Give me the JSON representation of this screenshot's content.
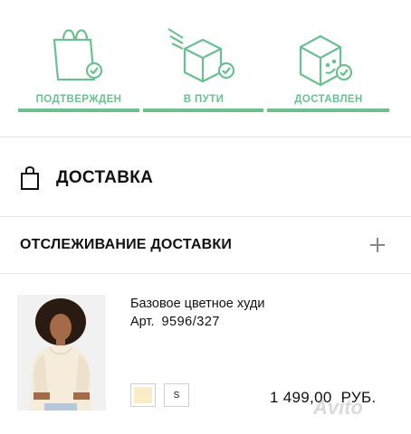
{
  "order_status": {
    "steps": [
      {
        "label": "ПОДТВЕРЖДЕН"
      },
      {
        "label": "В ПУТИ"
      },
      {
        "label": "ДОСТАВЛЕН"
      }
    ],
    "accent_color": "#6dbf92"
  },
  "delivery": {
    "title": "ДОСТАВКА",
    "icon": "shopping-bag-icon"
  },
  "tracking": {
    "title": "ОТСЛЕЖИВАНИЕ ДОСТАВКИ",
    "toggle_icon": "plus-icon"
  },
  "product": {
    "name": "Базовое цветное худи",
    "article_label": "Арт.",
    "article_number": "9596/327",
    "color_swatch": "#fbecc8",
    "size": "S",
    "price": "1 499,00",
    "currency": "РУБ."
  },
  "watermark": "Avito"
}
